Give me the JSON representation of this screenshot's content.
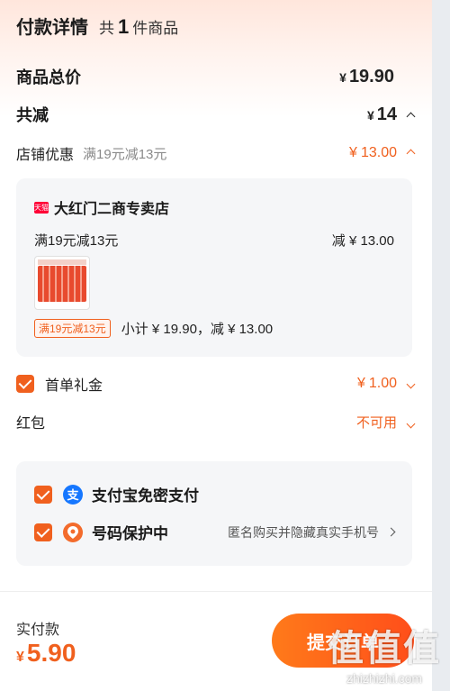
{
  "header": {
    "title": "付款详情",
    "count_prefix": "共",
    "count": "1",
    "count_suffix": "件商品"
  },
  "total": {
    "label": "商品总价",
    "currency": "¥",
    "amount": "19.90"
  },
  "discount": {
    "label": "共减",
    "currency": "¥",
    "amount": "14"
  },
  "shop_promo": {
    "label": "店铺优惠",
    "desc": "满19元减13元",
    "currency": "¥",
    "amount": "13.00"
  },
  "store": {
    "badge": "天猫",
    "name": "大红门二商专卖店",
    "promo_text": "满19元减13元",
    "promo_value": "减 ¥ 13.00",
    "tag": "满19元减13元",
    "subtotal": "小计 ¥ 19.90，减 ¥ 13.00"
  },
  "first_order": {
    "label": "首单礼金",
    "currency": "¥",
    "amount": "1.00"
  },
  "red_packet": {
    "label": "红包",
    "status": "不可用"
  },
  "payment": {
    "alipay_icon": "支",
    "alipay_label": "支付宝免密支付",
    "phone_label": "号码保护中",
    "phone_desc": "匿名购买并隐藏真实手机号"
  },
  "footer": {
    "label": "实付款",
    "currency": "¥",
    "amount": "5.90",
    "submit": "提交订单"
  },
  "watermark": {
    "big": "值值值",
    "small": "zhizhizhi.com"
  },
  "colors": {
    "accent": "#f0601e",
    "alipay": "#1677ff"
  }
}
